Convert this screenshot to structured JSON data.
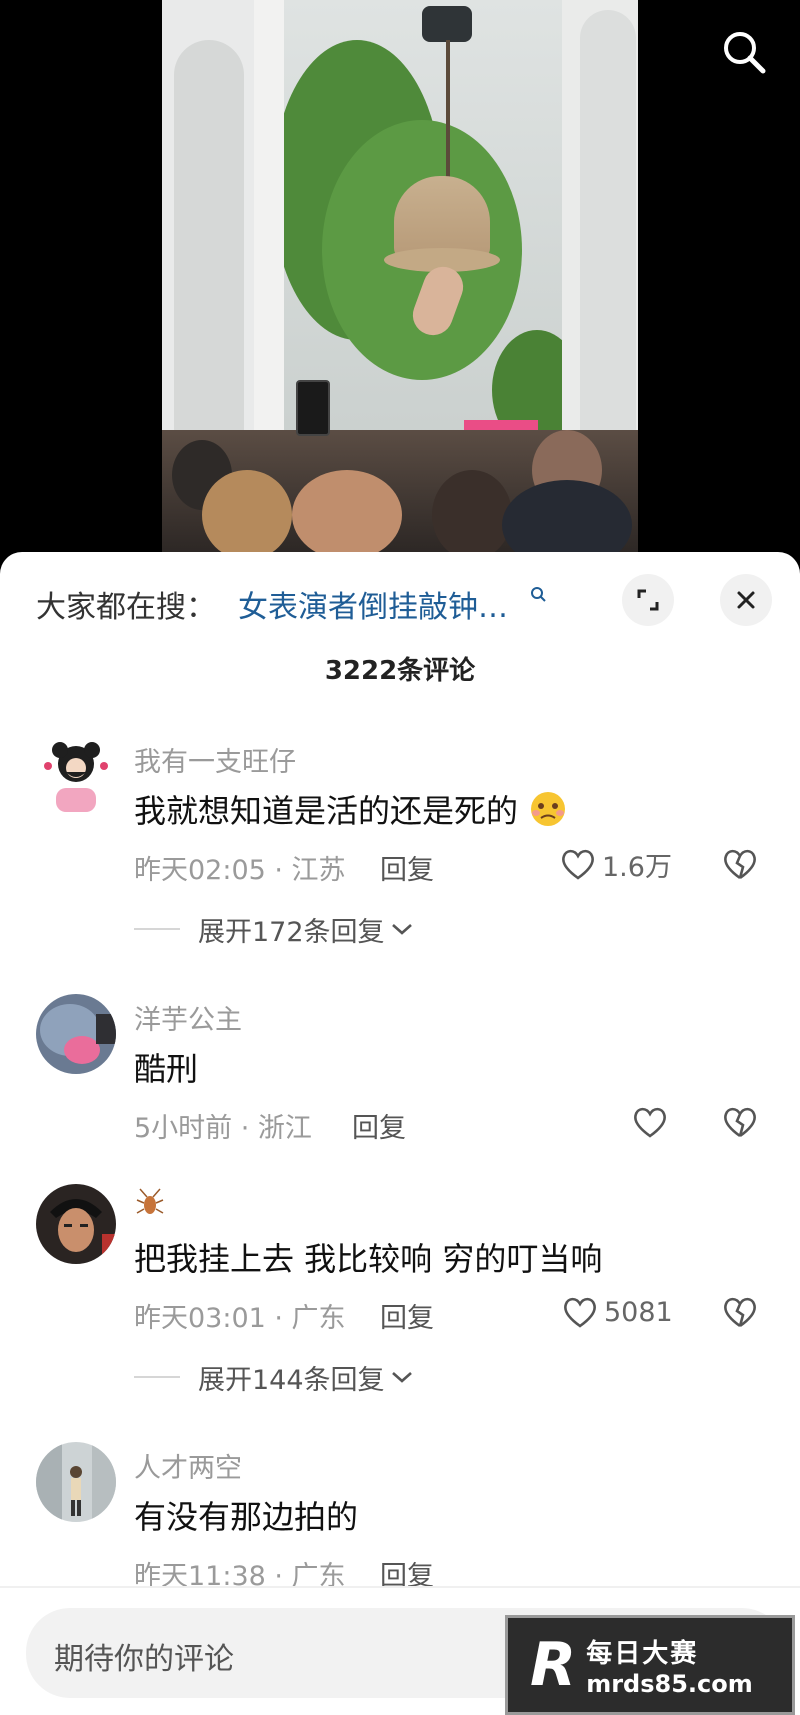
{
  "video": {
    "search_icon": "search-icon"
  },
  "sheet": {
    "hot_search_prefix": "大家都在搜：",
    "hot_search_query": "女表演者倒挂敲钟…",
    "comment_count": "3222条评论"
  },
  "comments": [
    {
      "username": "我有一支旺仔",
      "text": "我就想知道是活的还是死的",
      "time": "昨天02:05 · 江苏",
      "reply_label": "回复",
      "likes": "1.6万",
      "expand_label": "展开172条回复"
    },
    {
      "username": "洋芋公主",
      "text": "酷刑",
      "time": "5小时前 · 浙江",
      "reply_label": "回复",
      "likes": ""
    },
    {
      "username": "",
      "text": "把我挂上去 我比较响 穷的叮当响",
      "time": "昨天03:01 · 广东",
      "reply_label": "回复",
      "likes": "5081",
      "expand_label": "展开144条回复"
    },
    {
      "username": "人才两空",
      "text": "有没有那边拍的",
      "time": "昨天11:38 · 广东",
      "reply_label": "回复",
      "likes": ""
    }
  ],
  "input": {
    "placeholder": "期待你的评论"
  },
  "watermark": {
    "line1": "每日大赛",
    "line2": "mrds85.com"
  },
  "colors": {
    "accent_link": "#1f5d96",
    "muted": "#9a9a9a"
  }
}
